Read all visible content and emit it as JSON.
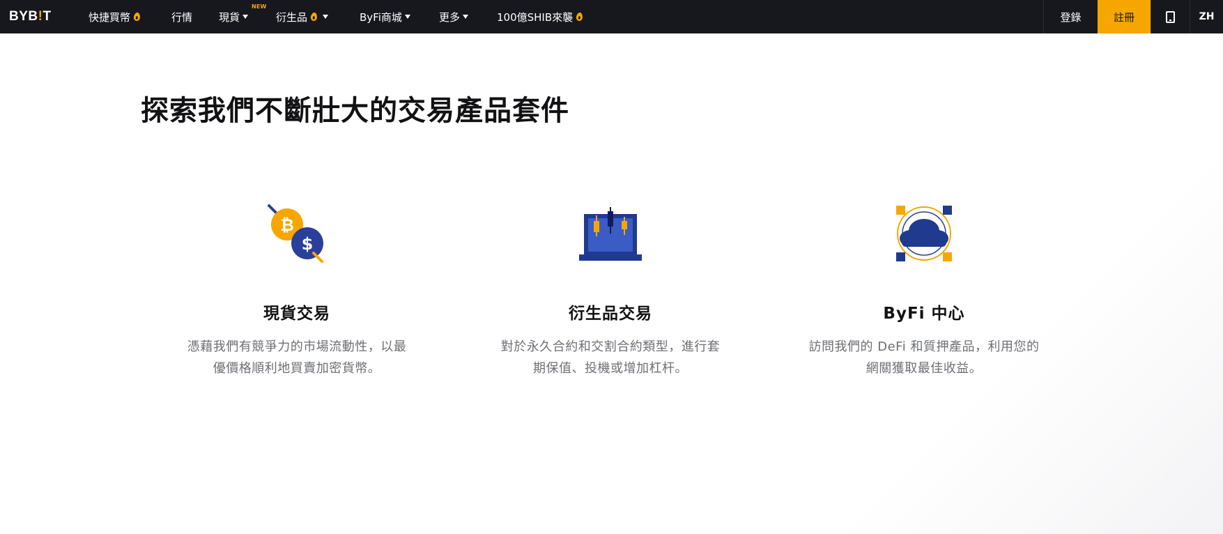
{
  "nav": {
    "logo_main": "BYB",
    "logo_bar": "!",
    "logo_end": "T",
    "items": [
      {
        "label": "快捷買幣"
      },
      {
        "label": "行情"
      },
      {
        "label": "現貨"
      },
      {
        "label": "衍生品"
      },
      {
        "label": "ByFi商城"
      },
      {
        "label": "更多"
      },
      {
        "label": "100億SHIB來襲"
      }
    ],
    "new_badge": "NEW",
    "login_label": "登錄",
    "signup_label": "註冊",
    "lang_label": "ZH"
  },
  "main": {
    "headline": "探索我們不斷壯大的交易產品套件",
    "cards": [
      {
        "title": "現貨交易",
        "desc_line1": "憑藉我們有競爭力的市場流動性，以最",
        "desc_line2": "優價格順利地買賣加密貨幣。",
        "icon": "crypto-exchange-icon"
      },
      {
        "title": "衍生品交易",
        "desc_line1": "對於永久合約和交割合約類型，進行套",
        "desc_line2": "期保值、投機或增加杠杆。",
        "icon": "candlestick-laptop-icon"
      },
      {
        "title": "ByFi 中心",
        "desc_line1": "訪問我們的 DeFi 和質押產品，利用您的",
        "desc_line2": "網關獲取最佳收益。",
        "icon": "cloud-network-icon"
      }
    ]
  },
  "colors": {
    "accent": "#f7a600",
    "nav_bg": "#17181e",
    "icon_blue": "#2a4aa6"
  }
}
